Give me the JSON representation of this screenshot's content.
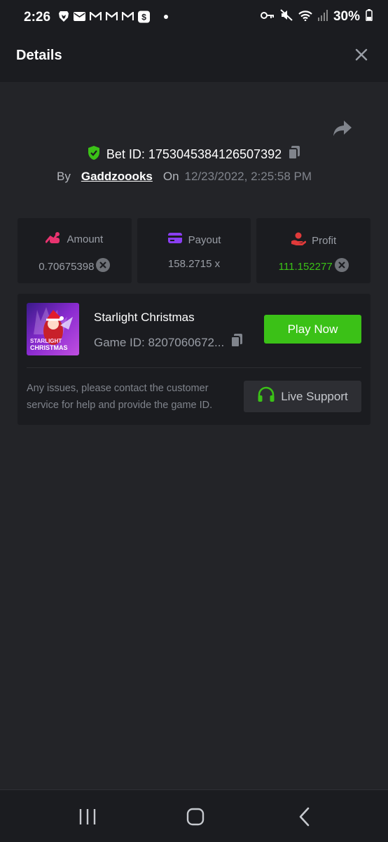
{
  "status_bar": {
    "time": "2:26",
    "battery": "30%",
    "left_icons": [
      "brave-icon",
      "mail-icon",
      "gmail-icon",
      "gmail-icon",
      "gmail-icon",
      "cash-app-icon",
      "dot-icon"
    ],
    "right_icons": [
      "key-icon",
      "mute-icon",
      "wifi-icon",
      "signal-icon",
      "battery-icon"
    ]
  },
  "header": {
    "title": "Details"
  },
  "bet": {
    "id_text": "Bet ID: 1753045384126507392",
    "by_label": "By",
    "user": "Gaddzoooks",
    "on_label": "On",
    "date": "12/23/2022, 2:25:58 PM"
  },
  "stats": {
    "amount": {
      "label": "Amount",
      "value": "0.70675398"
    },
    "payout": {
      "label": "Payout",
      "value": "158.2715 x"
    },
    "profit": {
      "label": "Profit",
      "value": "111.152277"
    }
  },
  "game": {
    "name": "Starlight Christmas",
    "id_text": "Game ID: 8207060672...",
    "thumb_text_1": "STARLIGHT",
    "thumb_text_2": "CHRISTMAS",
    "play_label": "Play Now",
    "help_text": "Any issues, please contact the customer service for help and provide the game ID.",
    "support_label": "Live Support"
  },
  "colors": {
    "background": "#232428",
    "panel": "#1b1c20",
    "accent_green": "#3bc117",
    "amount_icon": "#e8336f",
    "payout_icon": "#8a3ef2",
    "profit_icon": "#e03a3a"
  }
}
